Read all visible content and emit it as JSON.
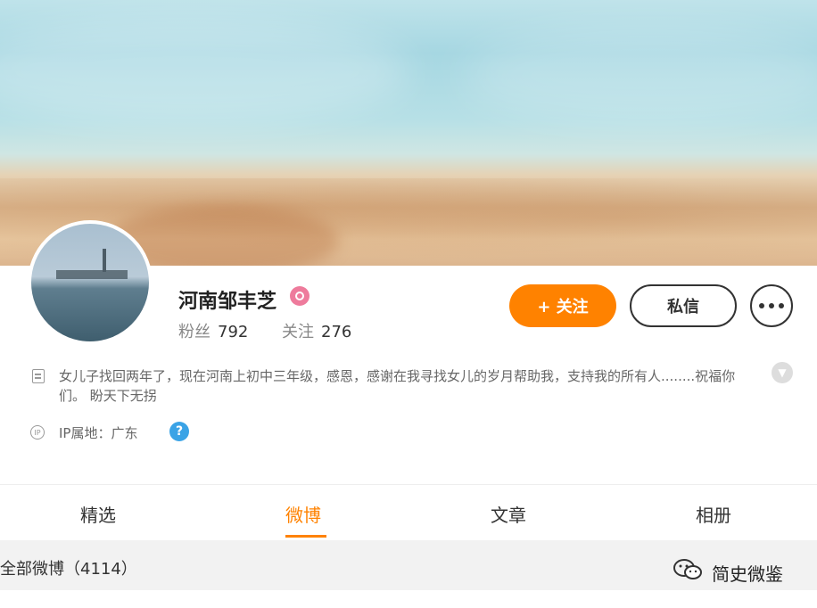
{
  "profile": {
    "name": "河南邹丰芝",
    "stats": {
      "fans_label": "粉丝",
      "fans": "792",
      "following_label": "关注",
      "following": "276"
    },
    "bio": "女儿子找回两年了，现在河南上初中三年级，感恩，感谢在我寻找女儿的岁月帮助我，支持我的所有人........祝福你们。 盼天下无拐",
    "ip_text": "IP属地：广东"
  },
  "actions": {
    "follow_label": "+ 关注",
    "message_label": "私信"
  },
  "tabs": [
    "精选",
    "微博",
    "文章",
    "相册"
  ],
  "active_tab": "微博",
  "feed": {
    "title": "全部微博（4114）"
  },
  "watermark": {
    "text": "简史微鉴"
  },
  "colors": {
    "accent": "#ff8200",
    "verify": "#ee7b9c",
    "help": "#3aa3e6"
  },
  "icons": {
    "bio": "document-icon",
    "ip": "location-icon",
    "help": "question-icon",
    "more": "more-dots-icon",
    "expand": "chevron-down-icon"
  }
}
